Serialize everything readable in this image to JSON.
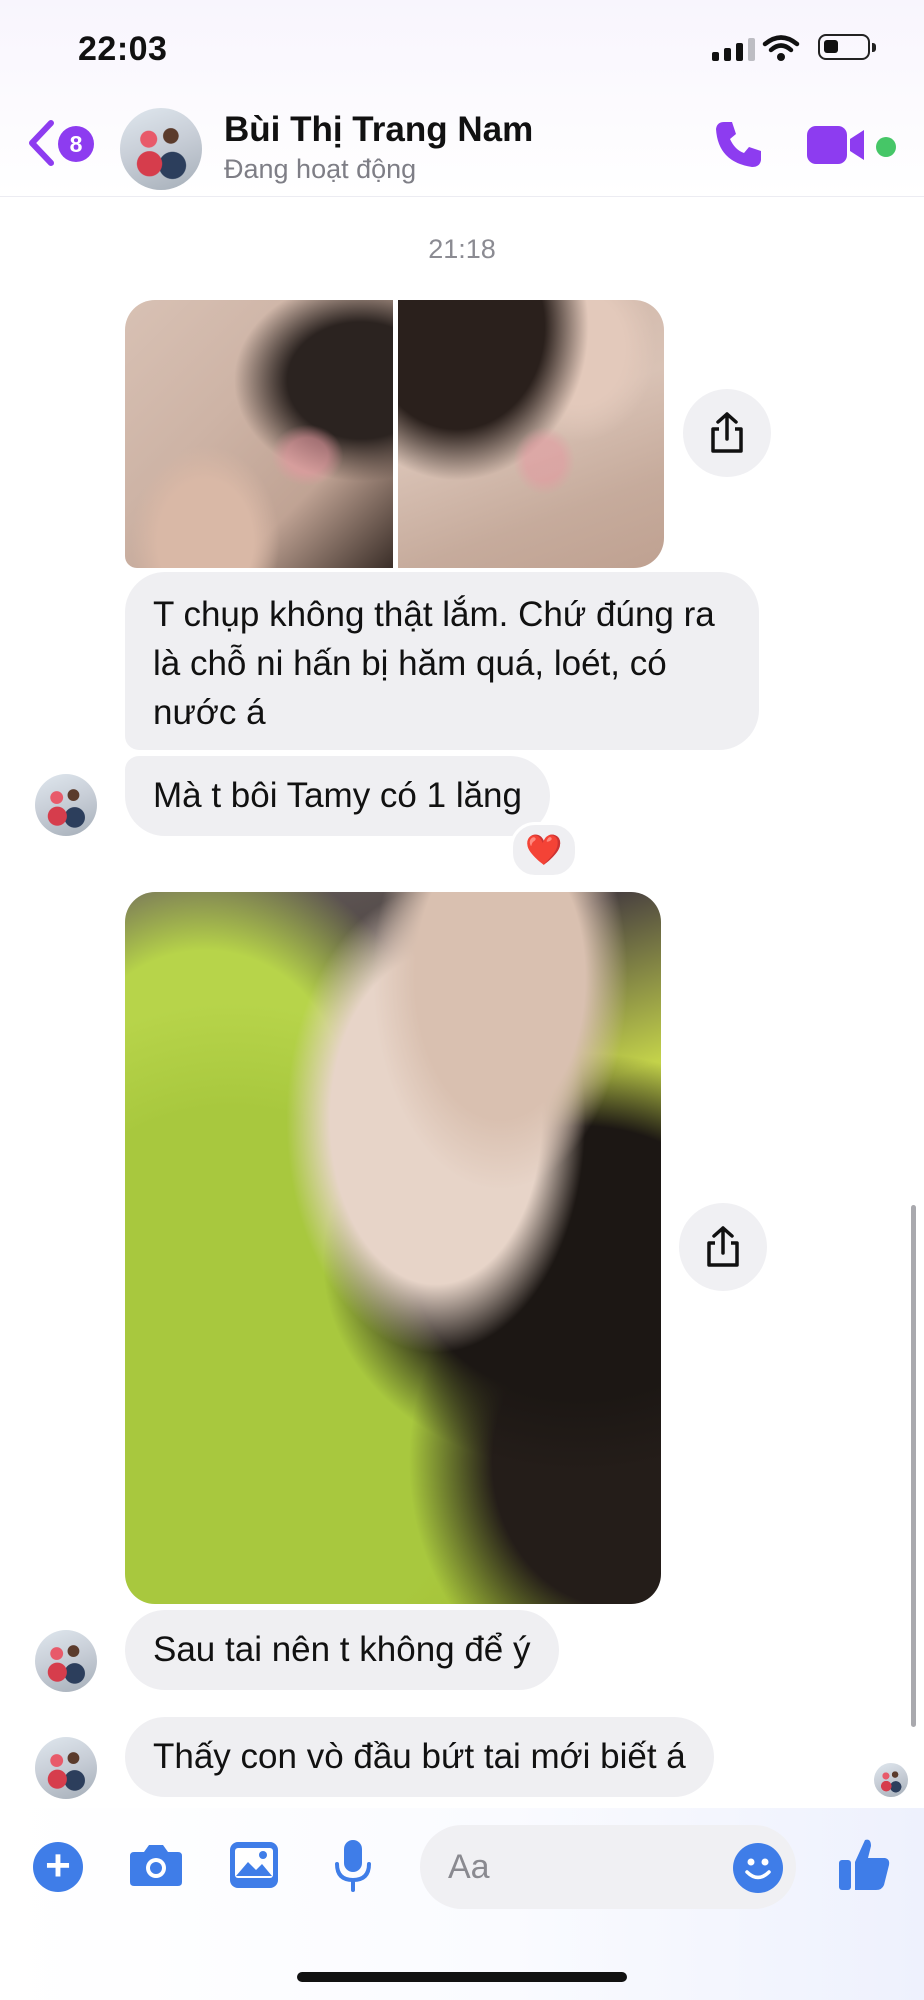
{
  "status_bar": {
    "time": "22:03"
  },
  "header": {
    "unread_count": "8",
    "contact_name": "Bùi Thị Trang Nam",
    "contact_status": "Đang hoạt động"
  },
  "conversation": {
    "timestamp": "21:18",
    "messages": [
      {
        "text": "T chụp không thật lắm. Chứ đúng ra là chỗ ni hấn bị hăm quá, loét, có nước á"
      },
      {
        "text": "Mà t bôi Tamy có 1 lăng",
        "reaction": "❤️"
      },
      {
        "text": "Sau tai nên t không để ý"
      },
      {
        "text": "Thấy con vò đầu bứt tai mới biết á"
      }
    ]
  },
  "composer": {
    "placeholder": "Aa"
  },
  "colors": {
    "accent": "#8d3cf0",
    "online": "#46c667",
    "tool_blue": "#3f7de8",
    "reaction": "#e0262d"
  },
  "icons": [
    "back-chevron-icon",
    "phone-icon",
    "video-camera-icon",
    "share-icon",
    "plus-icon",
    "camera-icon",
    "image-icon",
    "microphone-icon",
    "emoji-icon",
    "thumbs-up-icon"
  ]
}
